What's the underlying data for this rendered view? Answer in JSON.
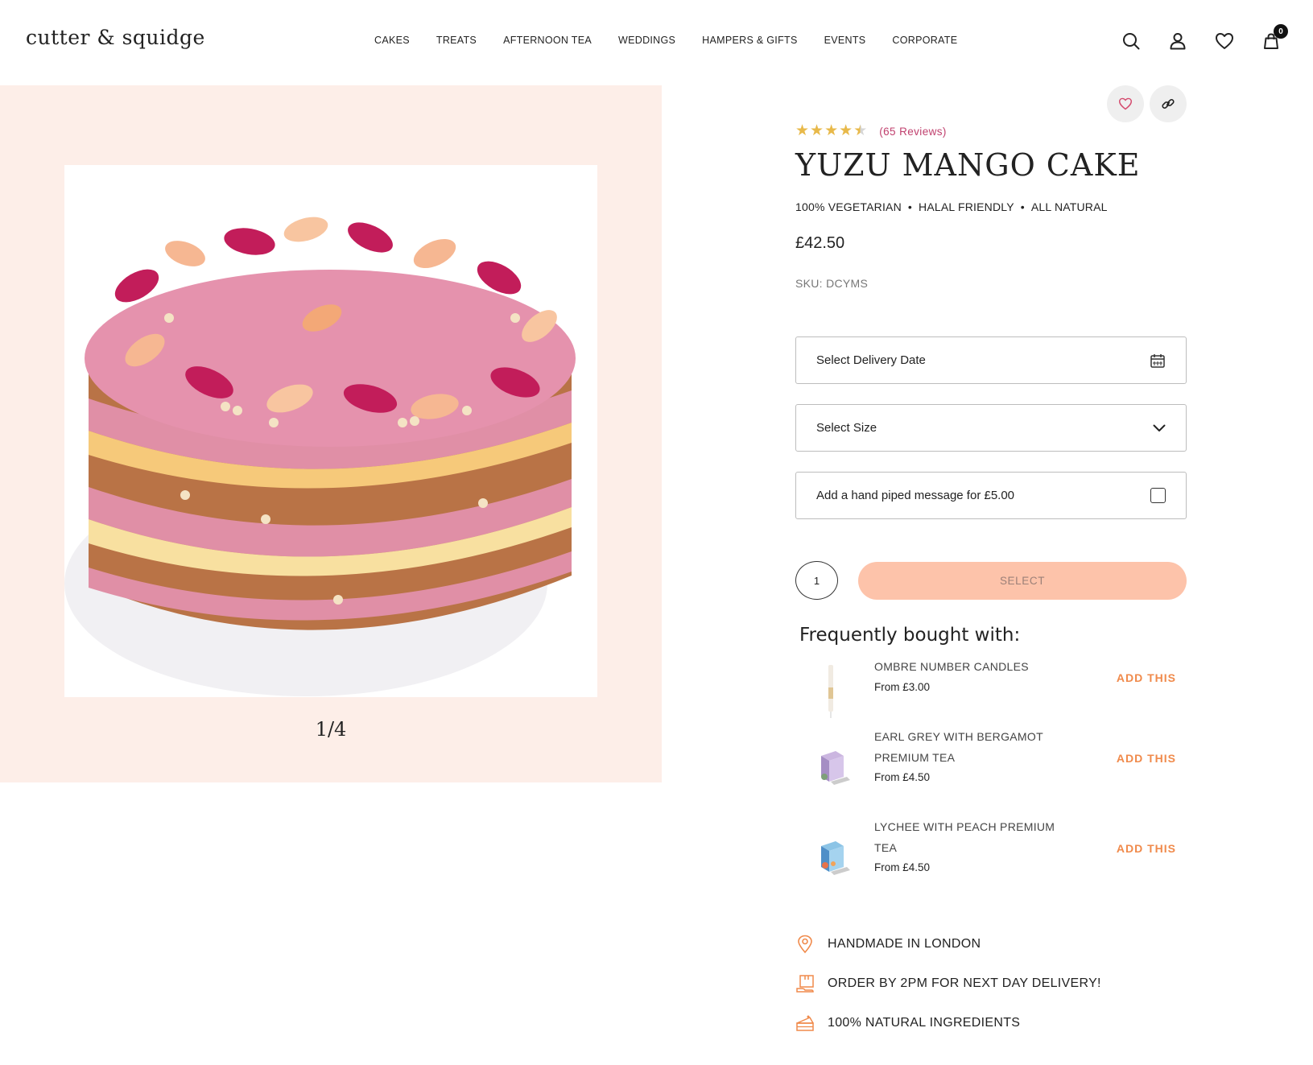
{
  "header": {
    "logo": "cutter & squidge",
    "nav": [
      "CAKES",
      "TREATS",
      "AFTERNOON TEA",
      "WEDDINGS",
      "HAMPERS & GIFTS",
      "EVENTS",
      "CORPORATE"
    ],
    "cart_count": "0",
    "icons": [
      "search-icon",
      "account-icon",
      "wishlist-heart-icon",
      "cart-bag-icon"
    ]
  },
  "gallery": {
    "counter": "1/4",
    "background_color": "#fdeee8"
  },
  "product": {
    "rating": 4.5,
    "reviews": "(65 Reviews)",
    "title": "YUZU MANGO CAKE",
    "tags": [
      "100% VEGETARIAN",
      "HALAL FRIENDLY",
      "ALL NATURAL"
    ],
    "tag_separator": "•",
    "price": "£42.50",
    "sku": "SKU: DCYMS",
    "delivery_date_label": "Select Delivery Date",
    "size_label": "Select Size",
    "message_label": "Add a hand piped message for £5.00",
    "quantity": "1",
    "select_button": "SELECT"
  },
  "frequently_bought": {
    "title": "Frequently bought with:",
    "items": [
      {
        "name": "OMBRE NUMBER CANDLES",
        "price": "From £3.00",
        "action": "ADD THIS"
      },
      {
        "name": "EARL GREY WITH BERGAMOT PREMIUM TEA",
        "price": "From £4.50",
        "action": "ADD THIS"
      },
      {
        "name": "LYCHEE WITH PEACH PREMIUM TEA",
        "price": "From £4.50",
        "action": "ADD THIS"
      }
    ]
  },
  "features": [
    {
      "icon": "location-pin-icon",
      "text": "HANDMADE IN LONDON"
    },
    {
      "icon": "delivery-box-icon",
      "text": "ORDER BY 2PM FOR NEXT DAY DELIVERY!"
    },
    {
      "icon": "cake-slice-icon",
      "text": "100% NATURAL INGREDIENTS"
    }
  ],
  "colors": {
    "accent_orange": "#f08a4b",
    "select_button": "#fdc3aa",
    "review_pink": "#c0406e",
    "star_gold": "#e8b94a"
  }
}
